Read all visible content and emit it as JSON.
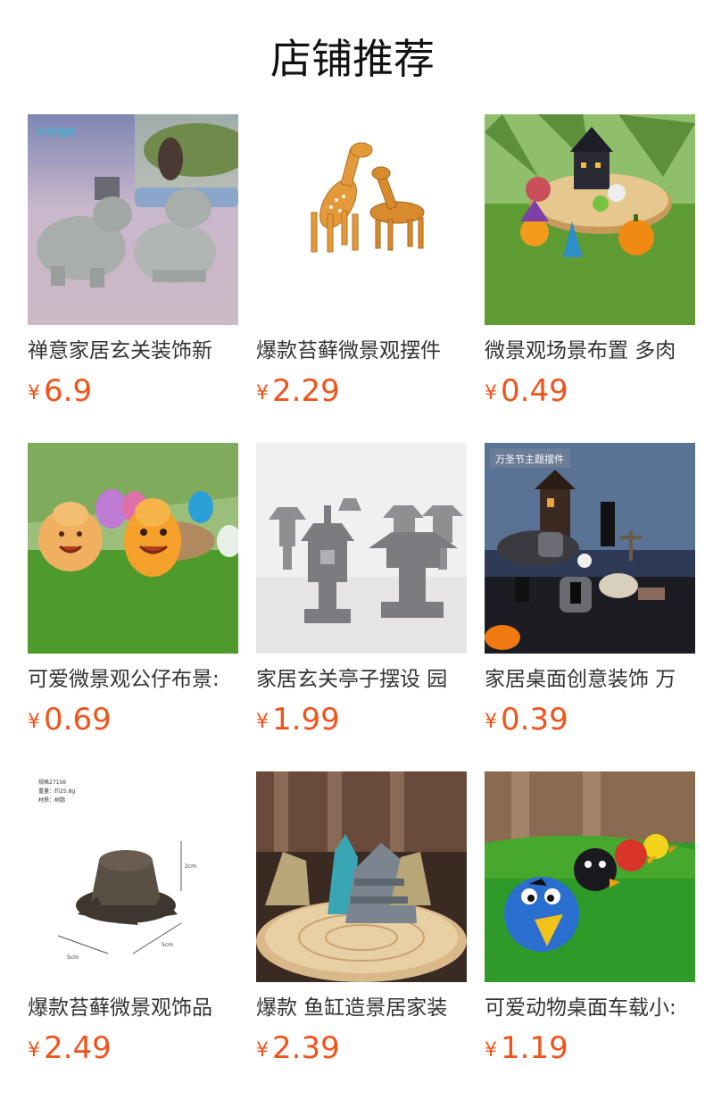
{
  "header": {
    "title": "店铺推荐"
  },
  "products": [
    {
      "name": "禅意家居玄关装饰新",
      "currency": "¥",
      "price": "6.9",
      "image_icon": "stone-animals-image",
      "watermark": "汐风萌影"
    },
    {
      "name": "爆款苔藓微景观摆件",
      "currency": "¥",
      "price": "2.29",
      "image_icon": "deer-figurines-image"
    },
    {
      "name": "微景观场景布置 多肉",
      "currency": "¥",
      "price": "0.49",
      "image_icon": "halloween-scene-image"
    },
    {
      "name": "可爱微景观公仔布景:",
      "currency": "¥",
      "price": "0.69",
      "image_icon": "cute-figurines-image"
    },
    {
      "name": "家居玄关亭子摆设 园",
      "currency": "¥",
      "price": "1.99",
      "image_icon": "stone-lanterns-image"
    },
    {
      "name": "家居桌面创意装饰 万",
      "currency": "¥",
      "price": "0.39",
      "image_icon": "halloween-graveyard-image",
      "overlay_tag": "万圣节主题摆件"
    },
    {
      "name": "爆款苔藓微景观饰品",
      "currency": "¥",
      "price": "2.49",
      "image_icon": "tree-stump-image",
      "spec_lines": [
        "规格27156",
        "重量：约25.8g",
        "材质：树脂"
      ],
      "dims": [
        "2cm",
        "5cm",
        "5cm"
      ]
    },
    {
      "name": "爆款 鱼缸造景居家装",
      "currency": "¥",
      "price": "2.39",
      "image_icon": "rockery-image"
    },
    {
      "name": "可爱动物桌面车载小:",
      "currency": "¥",
      "price": "1.19",
      "image_icon": "angry-birds-image"
    }
  ]
}
